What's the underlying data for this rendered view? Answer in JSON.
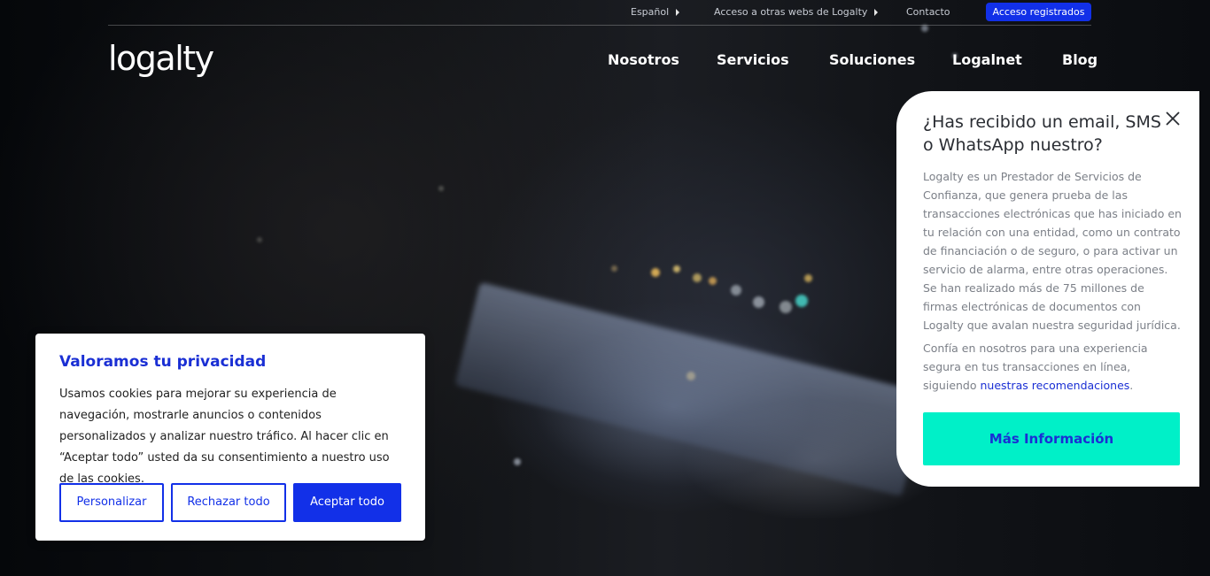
{
  "topbar": {
    "language": "Español",
    "other_sites": "Acceso a otras webs de Logalty",
    "contact": "Contacto",
    "access_button": "Acceso registrados"
  },
  "header": {
    "logo_text": "logalty",
    "nav": [
      "Nosotros",
      "Servicios",
      "Soluciones",
      "Logalnet",
      "Blog"
    ]
  },
  "cookie_banner": {
    "title": "Valoramos tu privacidad",
    "text": "Usamos cookies para mejorar su experiencia de navegación, mostrarle anuncios o contenidos personalizados y analizar nuestro tráfico. Al hacer clic en “Aceptar todo” usted da su consentimiento a nuestro uso de las cookies.",
    "customize": "Personalizar",
    "reject": "Rechazar todo",
    "accept": "Aceptar todo"
  },
  "info_panel": {
    "title": "¿Has recibido un email, SMS o WhatsApp nuestro?",
    "paragraph1": "Logalty es un Prestador de Servicios de Confianza, que genera prueba de las transacciones electrónicas que has iniciado en tu relación con una entidad, como un contrato de financiación o de seguro, o para activar un servicio de alarma, entre otras operaciones. Se han realizado más de 75 millones de firmas electrónicas de documentos con Logalty que avalan nuestra seguridad jurídica.",
    "paragraph2_prefix": "Confía en nosotros para una experiencia segura en tus transacciones en línea, siguiendo ",
    "paragraph2_link": "nuestras recomendaciones",
    "paragraph2_suffix": ".",
    "button": "Más Información",
    "close_icon": "close-icon"
  },
  "colors": {
    "brand_blue": "#1230e8",
    "accent_teal": "#00f0c8"
  }
}
